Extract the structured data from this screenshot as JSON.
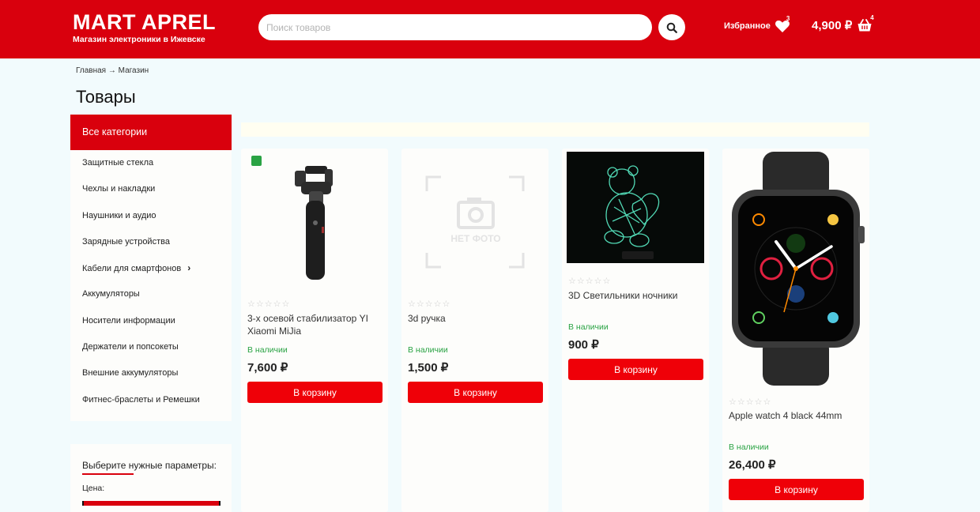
{
  "header": {
    "brand_name": "MART APREL",
    "brand_subtitle": "Магазин электроники в Ижевске",
    "search_placeholder": "Поиск товаров",
    "search_icon": "search-icon",
    "favorites_label": "Избранное",
    "favorites_count": "3",
    "cart_total": "4,900 ₽",
    "cart_count": "4",
    "accent_color": "#d9000d"
  },
  "breadcrumb": {
    "home": "Главная",
    "separator": "→",
    "current": "Магазин"
  },
  "page_title": "Товары",
  "sidebar": {
    "all_categories": "Все категории",
    "categories": [
      "Защитные стекла",
      "Чехлы и накладки",
      "Наушники и аудио",
      "Зарядные устройства",
      "Кабели для смартфонов",
      "Аккумуляторы",
      "Носители информации",
      "Держатели и попсокеты",
      "Внешние аккумуляторы",
      "Фитнес-браслеты и Ремешки"
    ],
    "expandable_index": 4
  },
  "filter": {
    "title": "Выберите нужные параметры:",
    "price_label": "Цена:"
  },
  "products": [
    {
      "name": "3-х осевой стабилизатор YI Xiaomi MiJia",
      "stock": "В наличии",
      "price": "7,600 ₽",
      "button": "В корзину",
      "rating_stars": "☆☆☆☆☆",
      "image": "gimbal-stabilizer-image"
    },
    {
      "name": "3d ручка",
      "stock": "В наличии",
      "price": "1,500 ₽",
      "button": "В корзину",
      "rating_stars": "☆☆☆☆☆",
      "image": "no-photo-placeholder",
      "placeholder_text": "НЕТ ФОТО"
    },
    {
      "name": "3D Светильники ночники",
      "stock": "В наличии",
      "price": "900 ₽",
      "button": "В корзину",
      "rating_stars": "☆☆☆☆☆",
      "image": "3d-night-lamp-image"
    },
    {
      "name": "Apple watch 4 black 44mm",
      "stock": "В наличии",
      "price": "26,400 ₽",
      "button": "В корзину",
      "rating_stars": "☆☆☆☆☆",
      "image": "apple-watch-image"
    }
  ]
}
